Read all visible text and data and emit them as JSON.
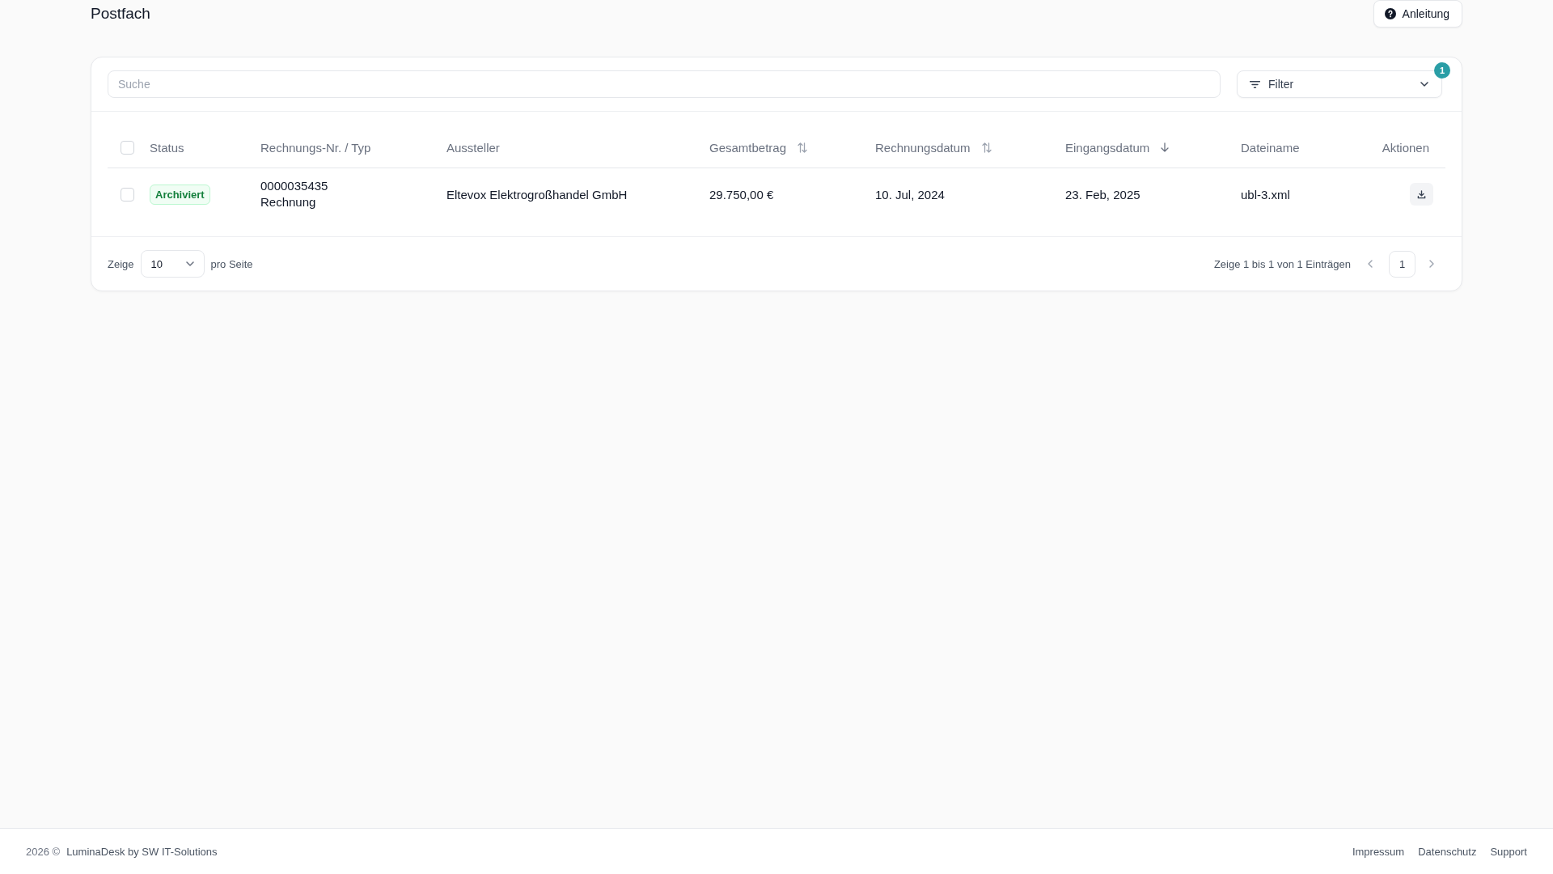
{
  "page": {
    "title": "Postfach",
    "help_button": "Anleitung"
  },
  "toolbar": {
    "search": {
      "placeholder": "Suche"
    },
    "filter": {
      "label": "Filter",
      "badge": "1"
    }
  },
  "table": {
    "select_all": {
      "checked": false
    },
    "columns": [
      {
        "label": "Status"
      },
      {
        "label": "Rechnungs-Nr. / Typ"
      },
      {
        "label": "Aussteller"
      },
      {
        "label": "Gesamtbetrag",
        "sorted_descending": false
      },
      {
        "label": "Rechnungsdatum",
        "sorted_descending": false
      },
      {
        "label": "Eingangsdatum",
        "sorted_descending": true
      },
      {
        "label": "Dateiname"
      },
      {
        "label": "Aktionen"
      }
    ],
    "rows": [
      {
        "checked": false,
        "status": "Archiviert",
        "number": "0000035435",
        "type": "Rechnung",
        "issuer": "Eltevox Elektrogroßhandel GmbH",
        "total": "29.750,00 €",
        "invoice_date": "10. Jul, 2024",
        "received_date": "23. Feb, 2025",
        "filename": "ubl-3.xml"
      }
    ]
  },
  "pagination": {
    "show_label": "Zeige",
    "per_page": "10",
    "per_page_label": "pro Seite",
    "info": "Zeige 1 bis 1 von 1 Einträgen",
    "pages": [
      {
        "label": "1",
        "selected": true
      }
    ]
  },
  "footer": {
    "copyright": "2026 ©",
    "credit": "LuminaDesk by SW IT-Solutions",
    "links": [
      "Impressum",
      "Datenschutz",
      "Support"
    ]
  }
}
